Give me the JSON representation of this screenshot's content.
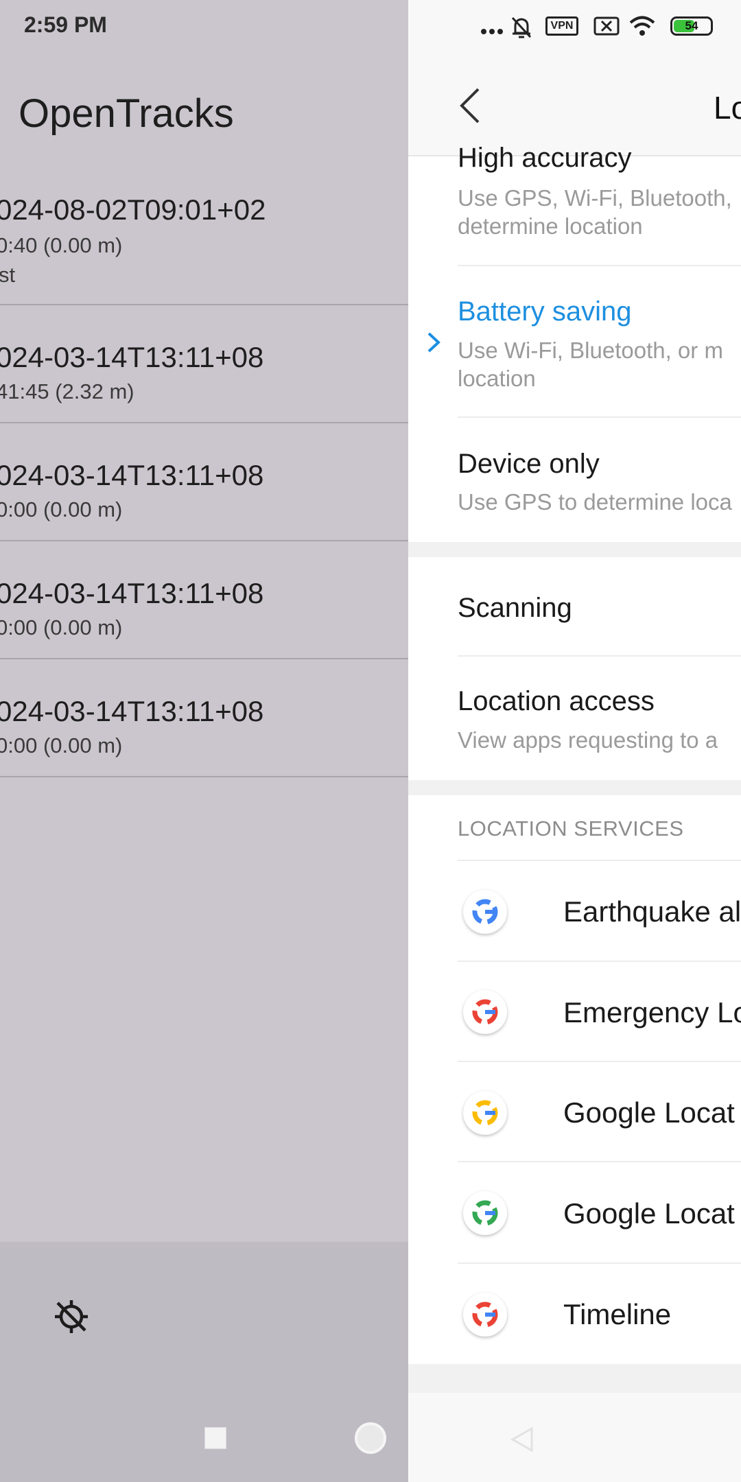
{
  "status": {
    "time": "2:59 PM",
    "vpn_label": "VPN",
    "battery_level": "54"
  },
  "left_app": {
    "title": "OpenTracks",
    "tracks": [
      {
        "name": "024-08-02T09:01+02",
        "stats": "0:40 (0.00 m)",
        "extra": "st"
      },
      {
        "name": "024-03-14T13:11+08",
        "stats": "41:45 (2.32 m)",
        "extra": ""
      },
      {
        "name": "024-03-14T13:11+08",
        "stats": "0:00 (0.00 m)",
        "extra": ""
      },
      {
        "name": "024-03-14T13:11+08",
        "stats": "0:00 (0.00 m)",
        "extra": ""
      },
      {
        "name": "024-03-14T13:11+08",
        "stats": "0:00 (0.00 m)",
        "extra": ""
      }
    ],
    "gps_icon": "gps-off-icon"
  },
  "right_app": {
    "header_title": "Lo",
    "modes": [
      {
        "title": "High accuracy",
        "sub1": "Use GPS, Wi-Fi, Bluetooth,",
        "sub2": "determine location"
      },
      {
        "title": "Battery saving",
        "sub1": "Use Wi-Fi, Bluetooth, or m",
        "sub2": "location"
      },
      {
        "title": "Device only",
        "sub1": "Use GPS to determine loca",
        "sub2": ""
      }
    ],
    "selected_mode": "Battery saving",
    "scanning": "Scanning",
    "location_access": {
      "title": "Location access",
      "sub": "View apps requesting to a"
    },
    "services_label": "LOCATION SERVICES",
    "services": [
      "Earthquake al",
      "Emergency Lo",
      "Google Locat",
      "Google Locat",
      "Timeline"
    ],
    "colors": {
      "accent": "#1d8fe0"
    }
  }
}
